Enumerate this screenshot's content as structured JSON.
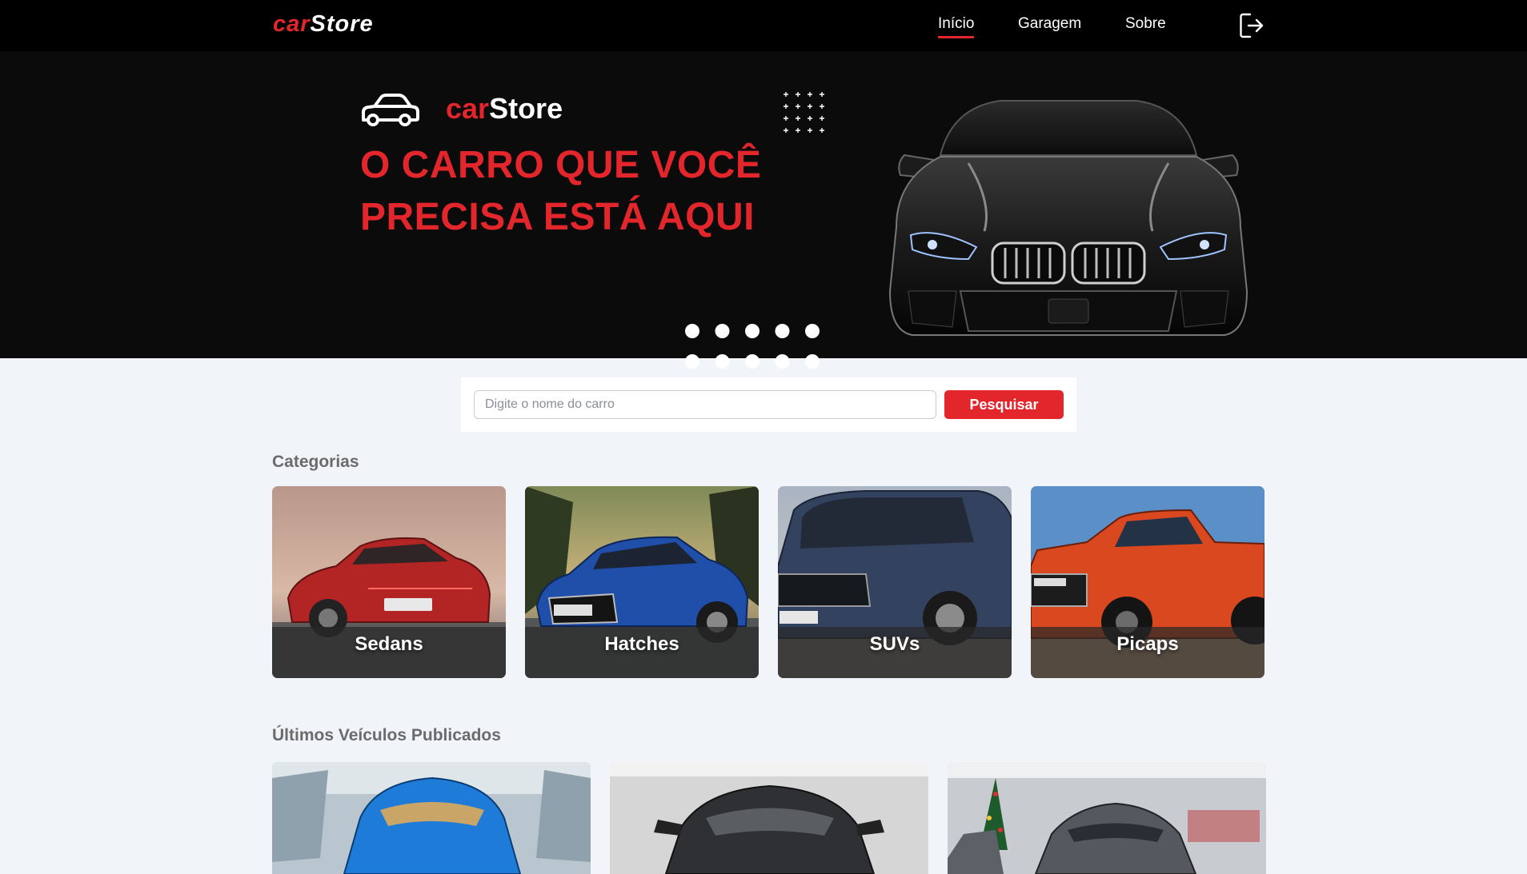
{
  "navbar": {
    "logo_car": "car",
    "logo_store": "Store",
    "links": [
      {
        "label": "Início",
        "active": true
      },
      {
        "label": "Garagem",
        "active": false
      },
      {
        "label": "Sobre",
        "active": false
      }
    ],
    "logout_icon": "logout-icon"
  },
  "hero": {
    "brand_car": "car",
    "brand_store": "Store",
    "headline_line1": "O CARRO QUE VOCÊ",
    "headline_line2": "PRECISA ESTÁ AQUI",
    "car_icon": "car-outline-icon"
  },
  "search": {
    "placeholder": "Digite o nome do carro",
    "value": "",
    "button_label": "Pesquisar"
  },
  "categories": {
    "title": "Categorias",
    "items": [
      {
        "label": "Sedans"
      },
      {
        "label": "Hatches"
      },
      {
        "label": "SUVs"
      },
      {
        "label": "Picaps"
      }
    ]
  },
  "latest": {
    "title": "Últimos Veículos Publicados",
    "items": [
      {
        "image": "blue-sports-car"
      },
      {
        "image": "dark-sedan"
      },
      {
        "image": "gray-car-showroom"
      }
    ]
  },
  "colors": {
    "accent": "#e3262b",
    "navbar_bg": "#000000",
    "hero_bg": "#0b0b0b",
    "page_bg": "#f1f4f8"
  }
}
